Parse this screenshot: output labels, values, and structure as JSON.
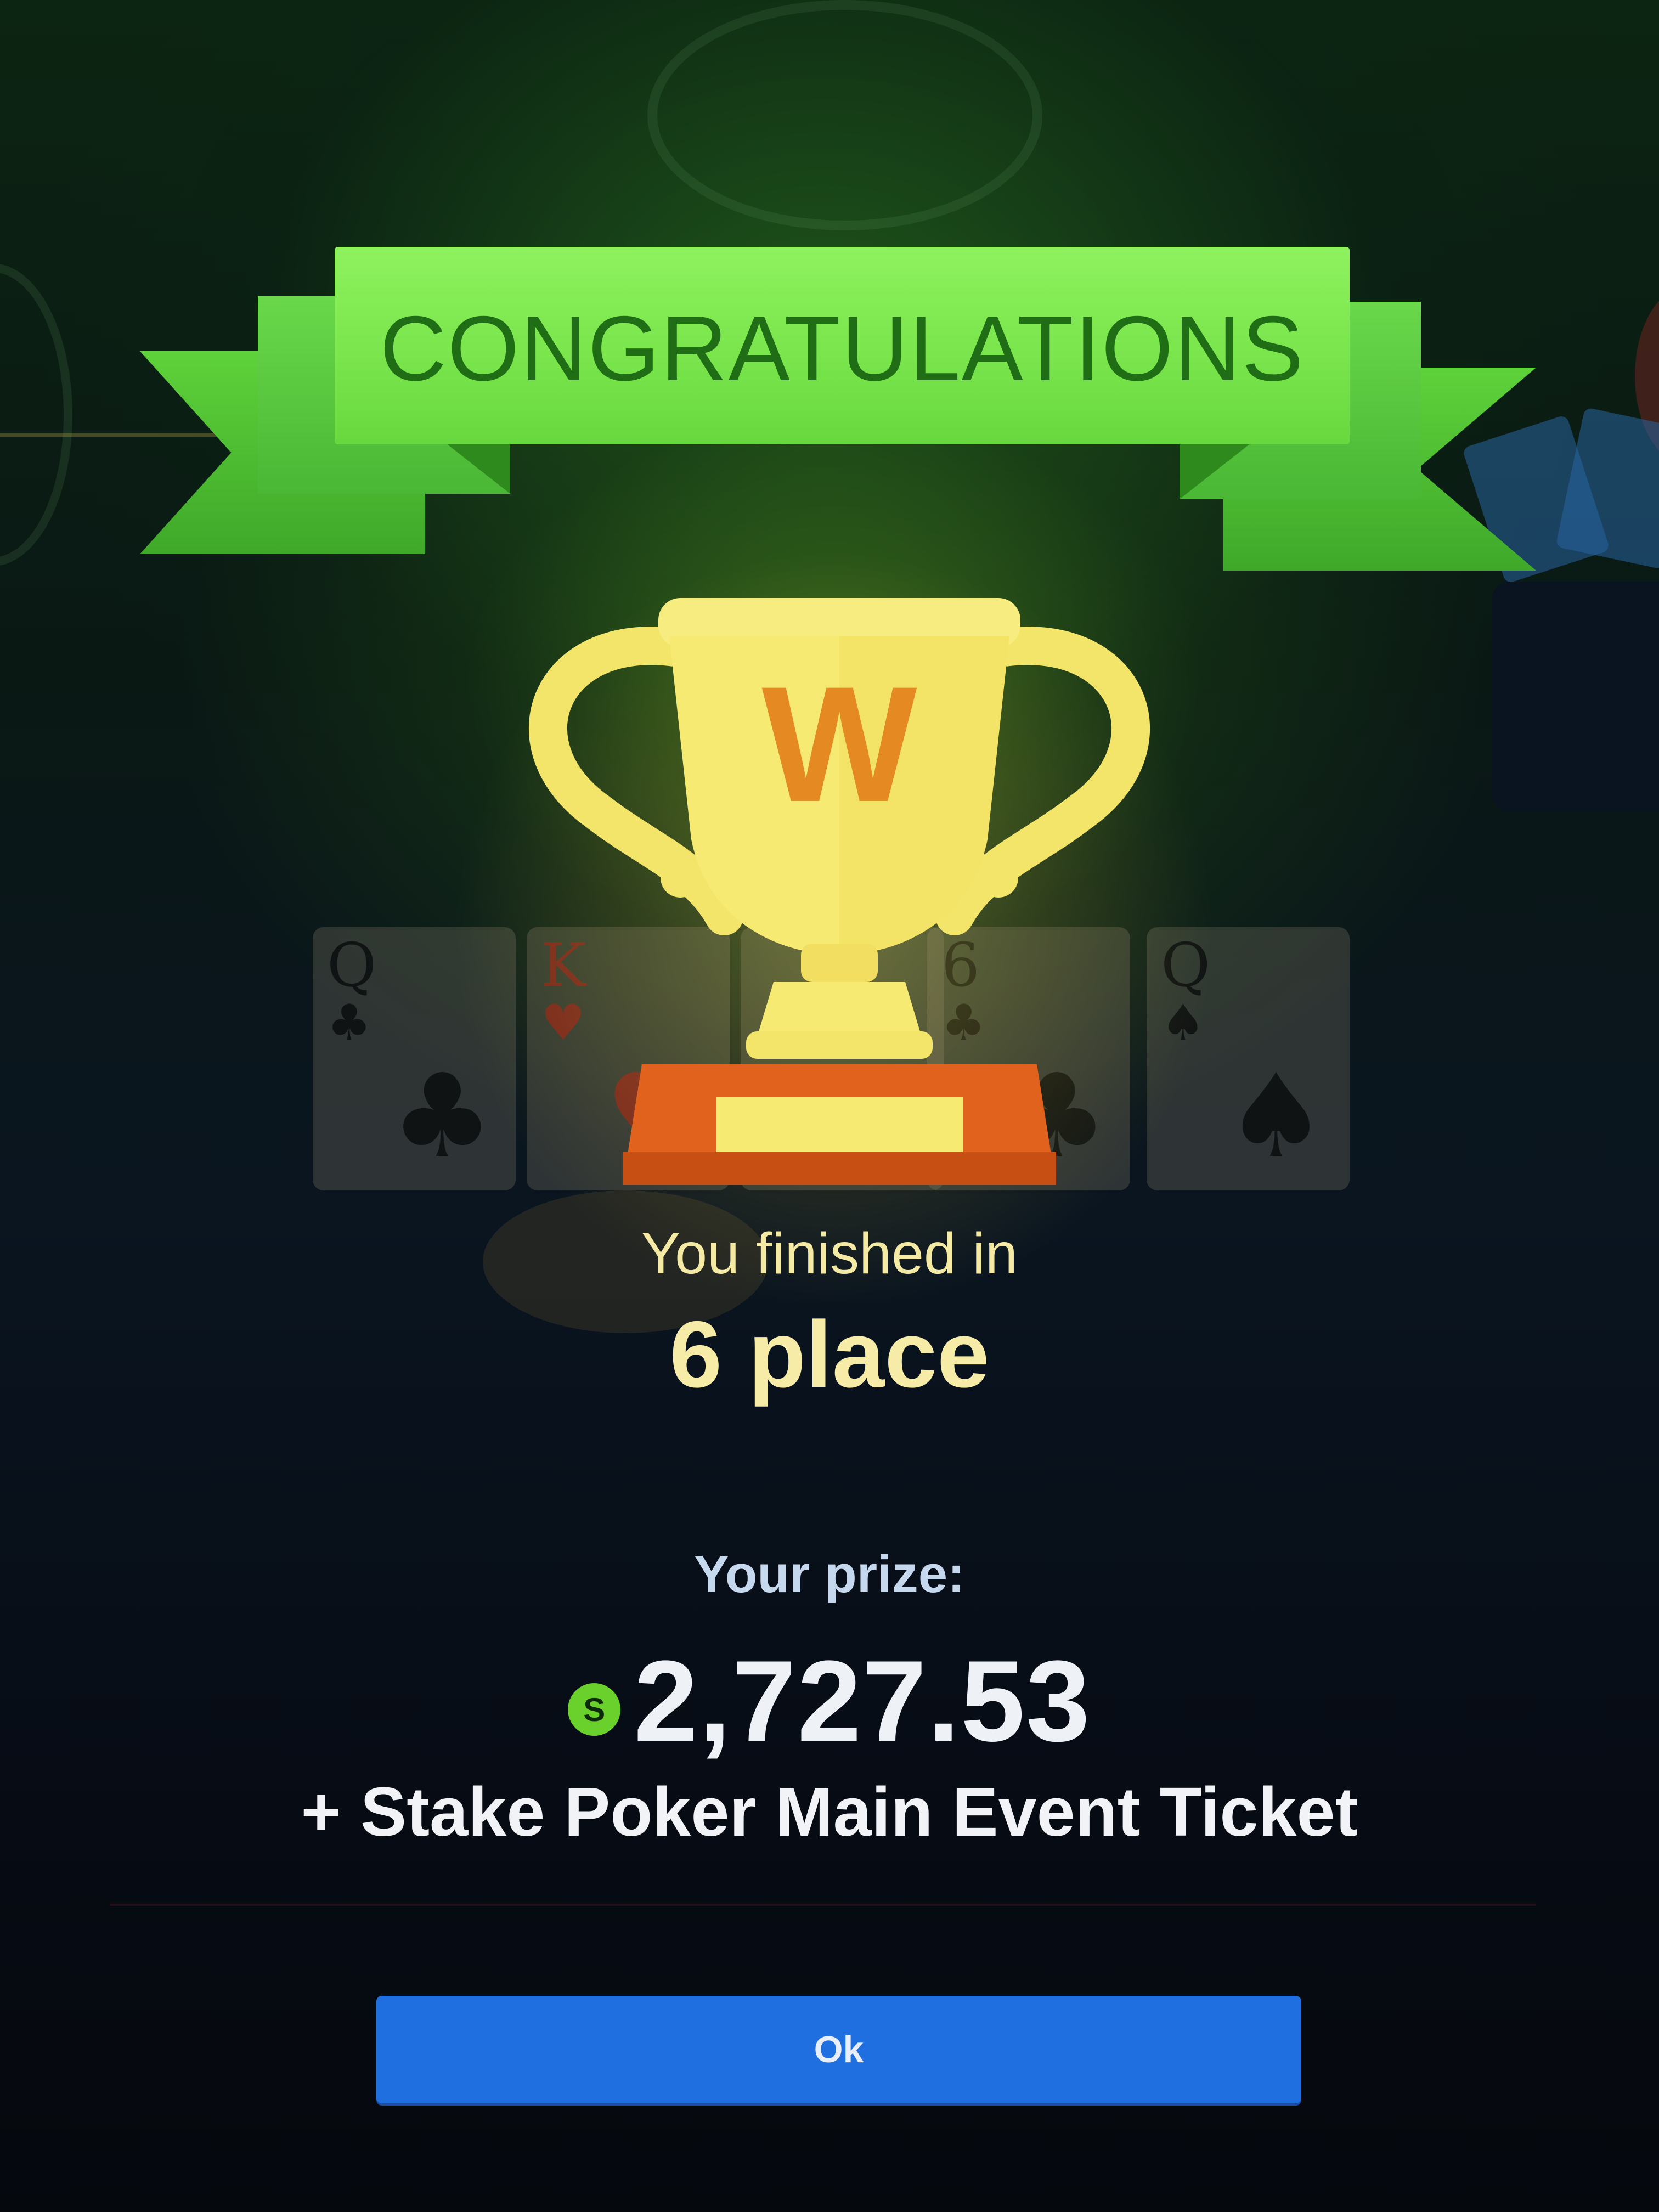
{
  "dialog": {
    "banner_title": "CONGRATULATIONS",
    "trophy_letter": "W",
    "finished_text": "You finished in",
    "place_text": "6 place",
    "prize_label": "Your prize:",
    "currency_symbol": "S",
    "prize_amount": "2,727.53",
    "ticket_text": "+ Stake Poker Main Event Ticket",
    "ok_label": "Ok"
  },
  "colors": {
    "ribbon_green": "#7ae54c",
    "ribbon_text": "#1f6e16",
    "trophy_gold": "#f6ea72",
    "trophy_base": "#e0621c",
    "button_blue": "#1f6fe0",
    "coin_green": "#6ad02c"
  },
  "icons": {
    "trophy": "trophy-icon",
    "coin": "stake-coin-icon"
  }
}
